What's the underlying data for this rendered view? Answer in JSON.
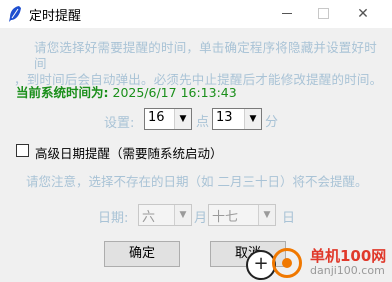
{
  "window": {
    "title": "定时提醒",
    "controls": {
      "minimize": "—",
      "maximize": "□",
      "close": "✕"
    }
  },
  "hint_top": {
    "line1": "请您选择好需要提醒的时间，单击确定程序将隐藏并设置好时间",
    "line2": "，到时间后会自动弹出。必须先中止提醒后才能修改提醒的时间。"
  },
  "current_time": {
    "label": "当前系统时间为:",
    "value": "2025/6/17 16:13:43"
  },
  "setting": {
    "label": "设置:",
    "hour": "16",
    "dian": "点",
    "minute": "13",
    "fen": "分"
  },
  "advanced": {
    "checked": false,
    "label": "高级日期提醒（需要随系统启动）"
  },
  "hint_date": "请您注意，选择不存在的日期（如 二月三十日）将不会提醒。",
  "date": {
    "label": "日期:",
    "month": "六",
    "yue": "月",
    "day": "十七",
    "ri": "日"
  },
  "buttons": {
    "ok": "确定",
    "cancel": "取消"
  },
  "watermark": {
    "line1": "单机100网",
    "line2": "danji100.com"
  },
  "colors": {
    "hint": "#a9c3d6",
    "time_green": "#1a8f1a",
    "watermark_orange": "#f07800",
    "watermark_red": "#e0392b"
  }
}
